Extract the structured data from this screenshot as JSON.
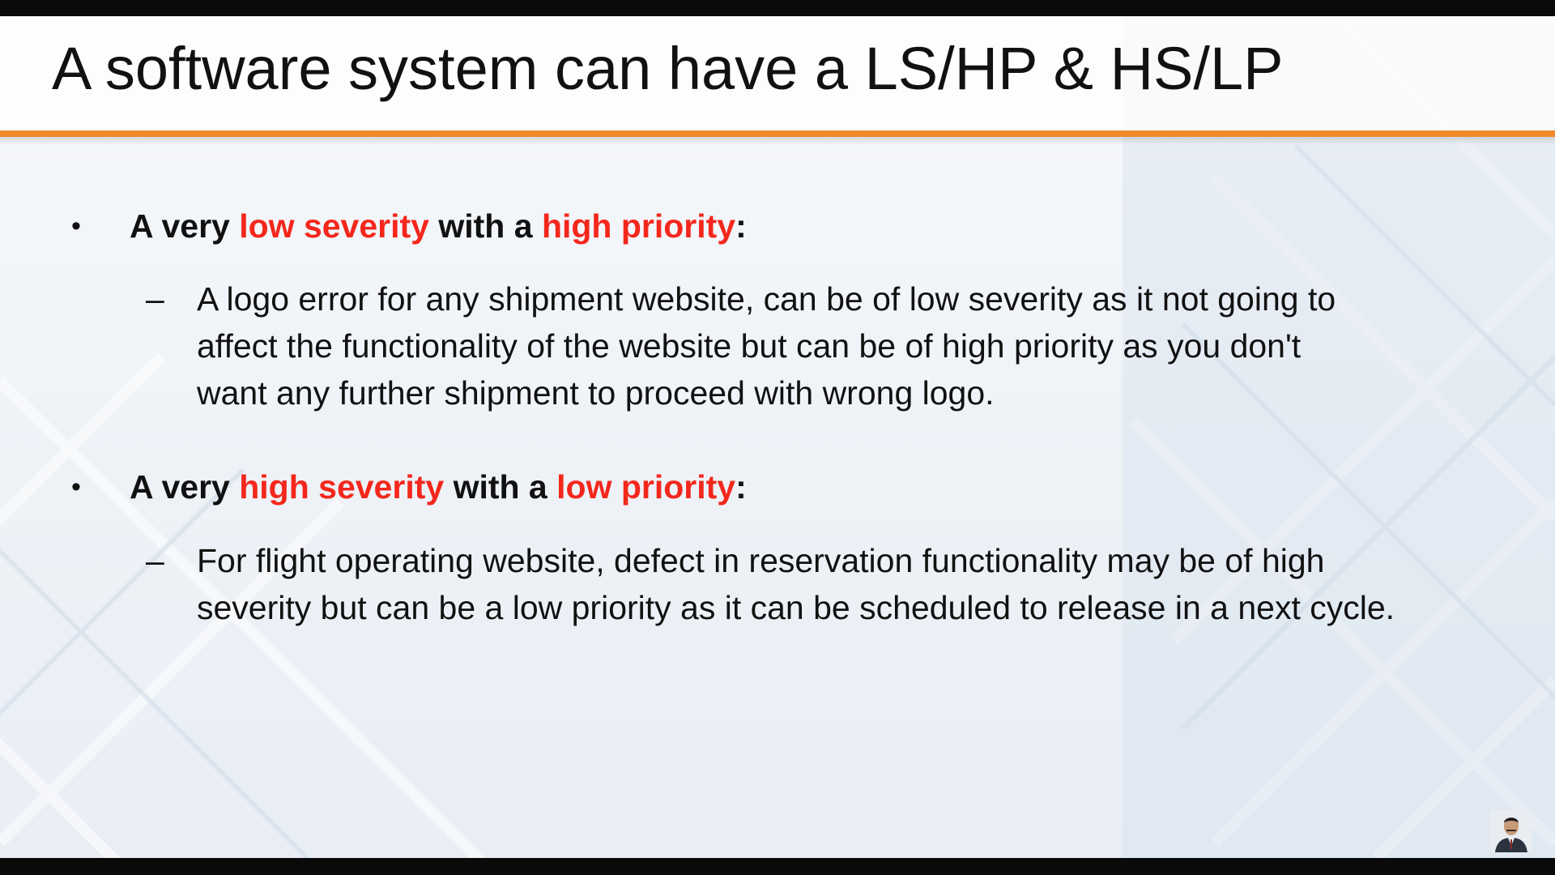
{
  "slide": {
    "title": "A software system can have a LS/HP & HS/LP",
    "accent_color": "#f08a2b",
    "highlight_color": "#f4271c",
    "bullets": [
      {
        "marker": "•",
        "prefix": "A very ",
        "highlight1": "low severity",
        "middle": " with a ",
        "highlight2": "high priority",
        "suffix": ":",
        "sub": {
          "marker": "–",
          "lines": [
            "A logo error for any shipment website, can be of low severity as it not going to",
            "affect the functionality of the website but can be of high priority as you don't",
            "want any further shipment to proceed with wrong logo."
          ]
        }
      },
      {
        "marker": "•",
        "prefix": "A very ",
        "highlight1": "high severity",
        "middle": " with a ",
        "highlight2": "low priority",
        "suffix": ":",
        "sub": {
          "marker": "–",
          "lines": [
            "For flight operating website, defect in reservation functionality may be of high",
            "severity but can be a low priority as it can be scheduled to release in a next cycle."
          ]
        }
      }
    ]
  },
  "presenter_thumbnail_icon": "presenter-avatar-icon"
}
